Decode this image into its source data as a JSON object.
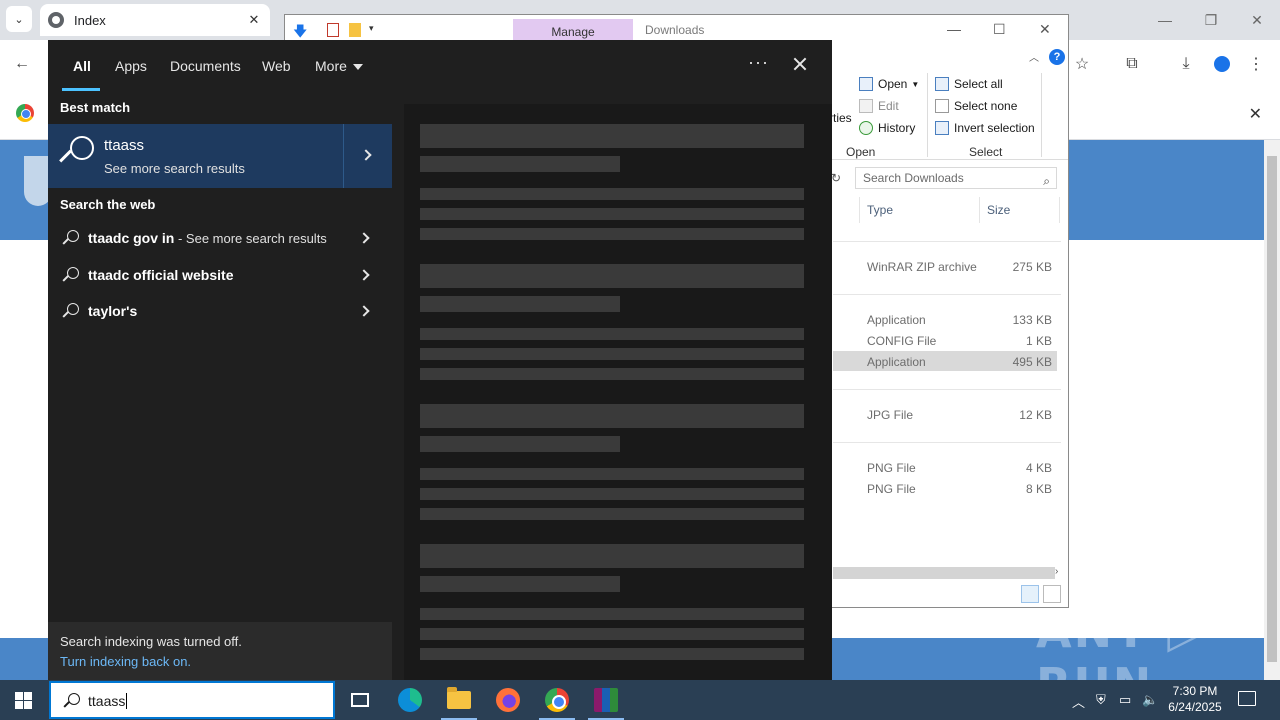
{
  "browser": {
    "tab_title": "Index",
    "tab_close": "✕",
    "tab_menu": "⌄",
    "window_controls": [
      "—",
      "❐",
      "✕"
    ],
    "toolbar_icons": [
      "back-icon",
      "star-icon",
      "extensions-icon",
      "download-icon",
      "profile-icon",
      "menu-icon"
    ],
    "infobar_close": "✕"
  },
  "explorer": {
    "title_tab_manage": "Manage",
    "title_downloads": "Downloads",
    "ribbon": {
      "properties_fragment": "rties",
      "open": "Open",
      "edit": "Edit",
      "history": "History",
      "select_all": "Select all",
      "select_none": "Select none",
      "invert_selection": "Invert selection",
      "group_open": "Open",
      "group_select": "Select"
    },
    "search_placeholder": "Search Downloads",
    "columns": {
      "type": "Type",
      "size": "Size"
    },
    "files": [
      {
        "type": "WinRAR ZIP archive",
        "size": "275 KB"
      },
      {
        "type": "Application",
        "size": "133 KB"
      },
      {
        "type": "CONFIG File",
        "size": "1 KB"
      },
      {
        "type": "Application",
        "size": "495 KB",
        "selected": true
      },
      {
        "type": "JPG File",
        "size": "12 KB"
      },
      {
        "type": "PNG File",
        "size": "4 KB"
      },
      {
        "type": "PNG File",
        "size": "8 KB"
      }
    ]
  },
  "search_panel": {
    "tabs": [
      "All",
      "Apps",
      "Documents",
      "Web",
      "More"
    ],
    "active_tab": "All",
    "more_options": "···",
    "best_match_heading": "Best match",
    "best_match": {
      "title": "ttaass",
      "subtitle": "See more search results"
    },
    "web_heading": "Search the web",
    "web_results": [
      {
        "bold": "ttaadc gov in",
        "suffix": " - See more search results"
      },
      {
        "bold": "ttaadc official website",
        "suffix": ""
      },
      {
        "bold": "taylor's",
        "suffix": ""
      }
    ],
    "indexing_message": "Search indexing was turned off.",
    "indexing_link": "Turn indexing back on."
  },
  "taskbar": {
    "search_text": "ttaass",
    "apps": [
      "task-view",
      "edge",
      "file-explorer",
      "firefox",
      "chrome",
      "winrar"
    ],
    "time": "7:30 PM",
    "date": "6/24/2025"
  },
  "watermark": "ANY ▷ RUN",
  "colors": {
    "panel_bg": "#1f1f1f",
    "best_match_bg": "#1e3a5f",
    "accent": "#4cc2ff",
    "taskbar_bg": "#2a3f54",
    "link": "#6cb8f6"
  }
}
